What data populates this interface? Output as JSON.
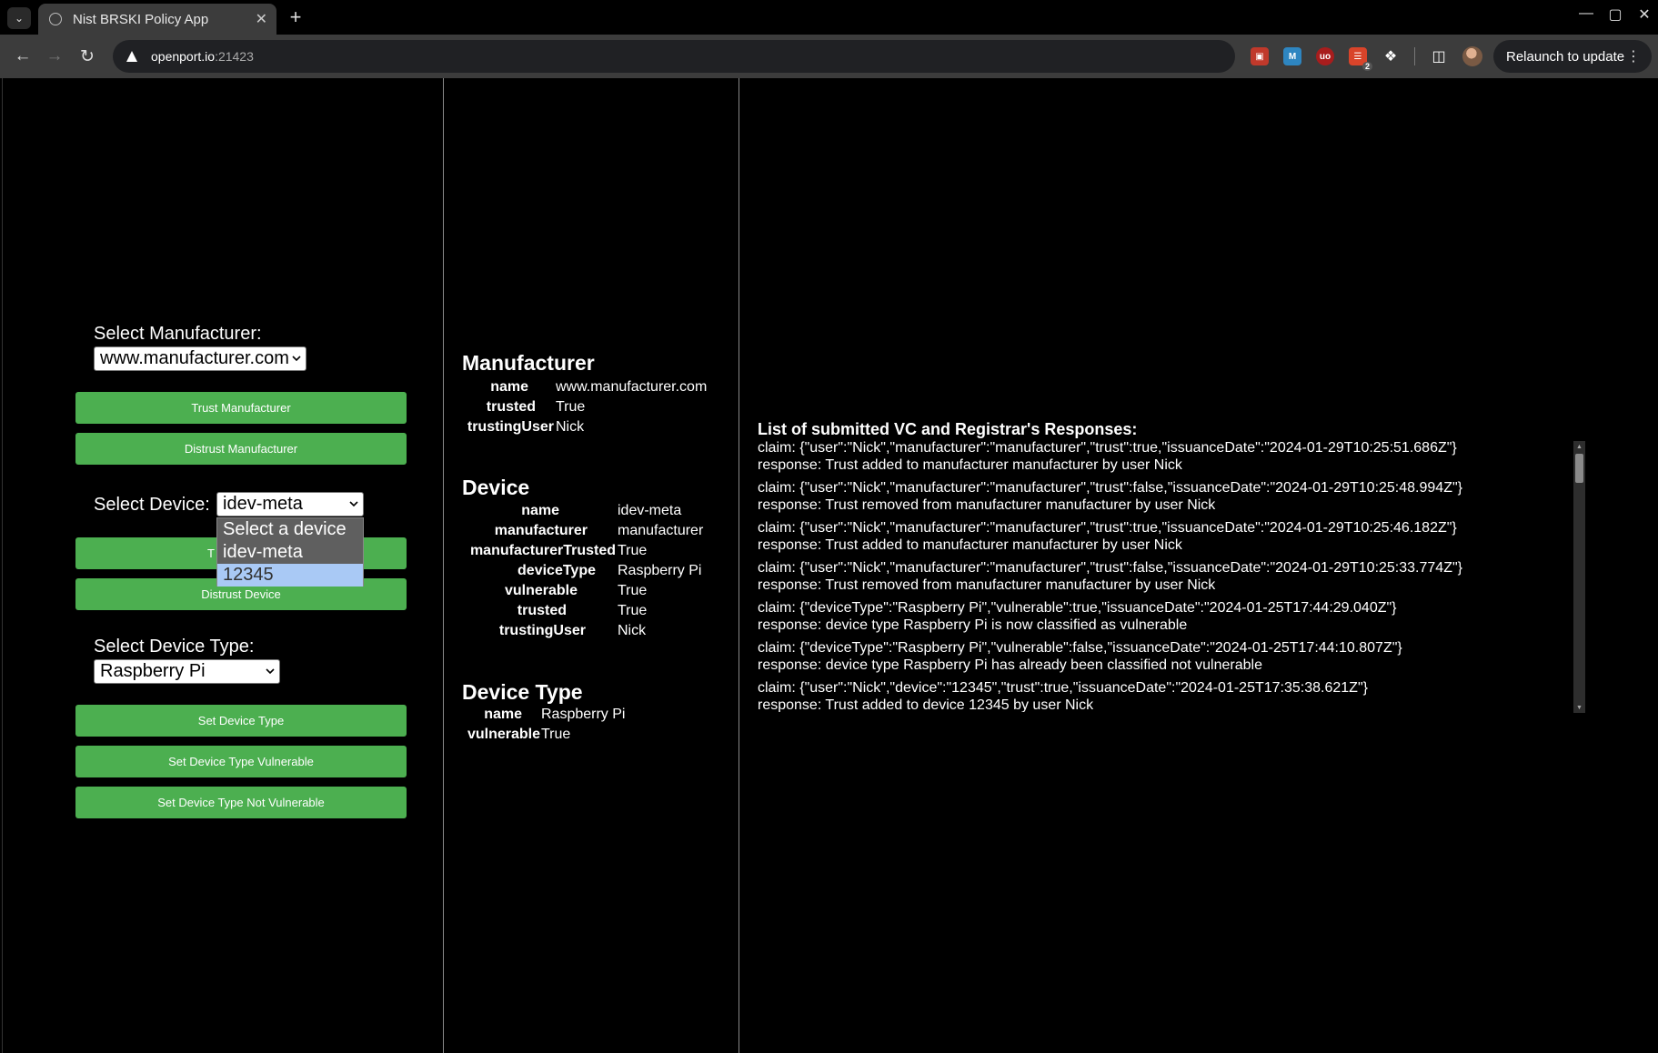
{
  "browser": {
    "tab_title": "Nist BRSKI Policy App",
    "url_host": "openport.io",
    "url_port": ":21423",
    "relaunch_label": "Relaunch to update",
    "extension_badge": "2"
  },
  "manufacturer_controls": {
    "label": "Select Manufacturer:",
    "selected": "www.manufacturer.com",
    "trust_button": "Trust Manufacturer",
    "distrust_button": "Distrust Manufacturer"
  },
  "device_controls": {
    "label": "Select Device:",
    "selected": "idev-meta",
    "trust_button": "T",
    "distrust_button": "Distrust Device",
    "options": [
      "Select a device",
      "idev-meta",
      "12345"
    ],
    "highlighted_option_index": 2
  },
  "device_type_controls": {
    "label": "Select Device Type:",
    "selected": "Raspberry Pi",
    "set_button": "Set Device Type",
    "vulnerable_button": "Set Device Type Vulnerable",
    "not_vulnerable_button": "Set Device Type Not Vulnerable"
  },
  "manufacturer_info": {
    "title": "Manufacturer",
    "rows": [
      {
        "key": "name",
        "value": "www.manufacturer.com"
      },
      {
        "key": "trusted",
        "value": "True"
      },
      {
        "key": "trustingUser",
        "value": "Nick"
      }
    ]
  },
  "device_info": {
    "title": "Device",
    "rows": [
      {
        "key": "name",
        "value": "idev-meta"
      },
      {
        "key": "manufacturer",
        "value": "manufacturer"
      },
      {
        "key": "manufacturerTrusted",
        "value": "True"
      },
      {
        "key": "deviceType",
        "value": "Raspberry Pi"
      },
      {
        "key": "vulnerable",
        "value": "True"
      },
      {
        "key": "trusted",
        "value": "True"
      },
      {
        "key": "trustingUser",
        "value": "Nick"
      }
    ]
  },
  "device_type_info": {
    "title": "Device Type",
    "rows": [
      {
        "key": "name",
        "value": "Raspberry Pi"
      },
      {
        "key": "vulnerable",
        "value": "True"
      }
    ]
  },
  "log": {
    "title": "List of submitted VC and Registrar's Responses:",
    "entries": [
      {
        "claim": "claim: {\"user\":\"Nick\",\"manufacturer\":\"manufacturer\",\"trust\":true,\"issuanceDate\":\"2024-01-29T10:25:51.686Z\"}",
        "response": "response: Trust added to manufacturer manufacturer by user Nick"
      },
      {
        "claim": "claim: {\"user\":\"Nick\",\"manufacturer\":\"manufacturer\",\"trust\":false,\"issuanceDate\":\"2024-01-29T10:25:48.994Z\"}",
        "response": "response: Trust removed from manufacturer manufacturer by user Nick"
      },
      {
        "claim": "claim: {\"user\":\"Nick\",\"manufacturer\":\"manufacturer\",\"trust\":true,\"issuanceDate\":\"2024-01-29T10:25:46.182Z\"}",
        "response": "response: Trust added to manufacturer manufacturer by user Nick"
      },
      {
        "claim": "claim: {\"user\":\"Nick\",\"manufacturer\":\"manufacturer\",\"trust\":false,\"issuanceDate\":\"2024-01-29T10:25:33.774Z\"}",
        "response": "response: Trust removed from manufacturer manufacturer by user Nick"
      },
      {
        "claim": "claim: {\"deviceType\":\"Raspberry Pi\",\"vulnerable\":true,\"issuanceDate\":\"2024-01-25T17:44:29.040Z\"}",
        "response": "response: device type Raspberry Pi is now classified as vulnerable"
      },
      {
        "claim": "claim: {\"deviceType\":\"Raspberry Pi\",\"vulnerable\":false,\"issuanceDate\":\"2024-01-25T17:44:10.807Z\"}",
        "response": "response: device type Raspberry Pi has already been classified not vulnerable"
      },
      {
        "claim": "claim: {\"user\":\"Nick\",\"device\":\"12345\",\"trust\":true,\"issuanceDate\":\"2024-01-25T17:35:38.621Z\"}",
        "response": "response: Trust added to device 12345 by user Nick"
      }
    ]
  }
}
